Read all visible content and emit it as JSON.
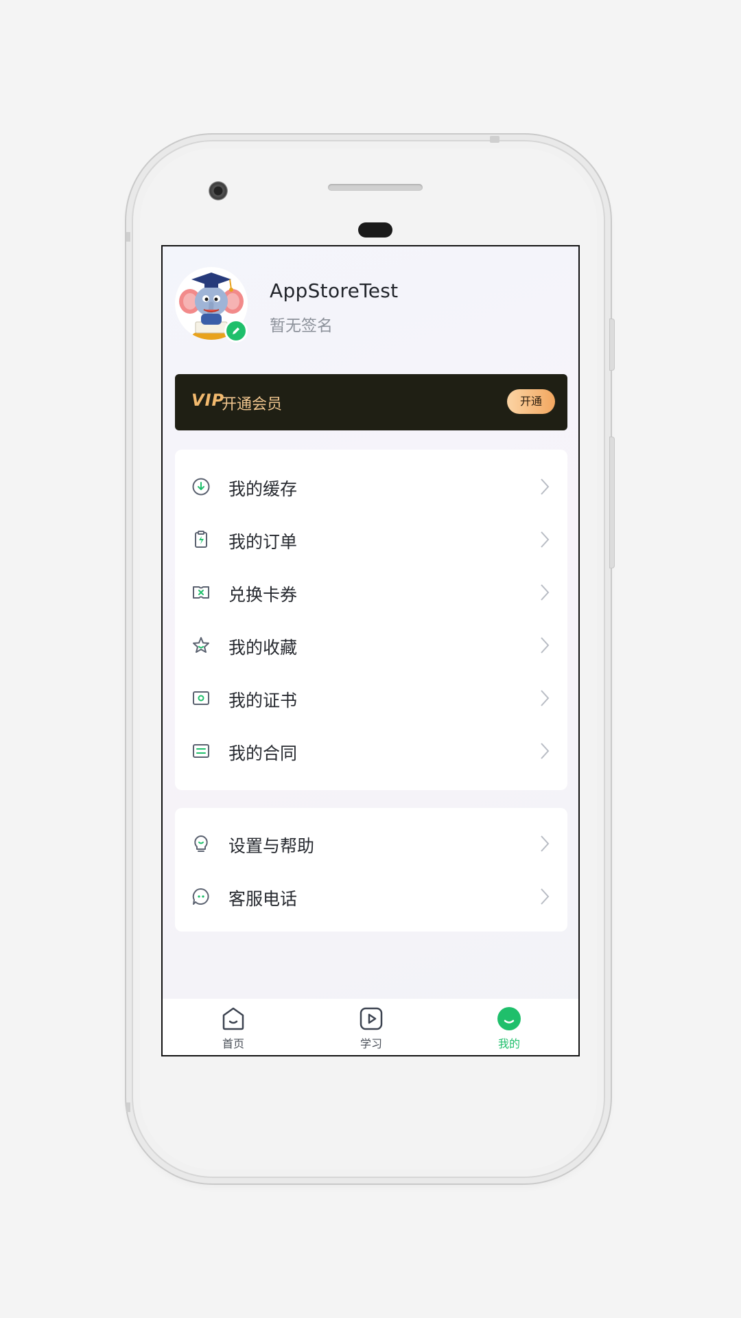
{
  "profile": {
    "username": "AppStoreTest",
    "signature": "暂无签名"
  },
  "vip": {
    "badge": "VIP",
    "label": "开通会员",
    "button": "开通"
  },
  "menu_primary": [
    {
      "label": "我的缓存",
      "icon": "download-circle-icon"
    },
    {
      "label": "我的订单",
      "icon": "clipboard-bolt-icon"
    },
    {
      "label": "兑换卡券",
      "icon": "ticket-icon"
    },
    {
      "label": "我的收藏",
      "icon": "star-icon"
    },
    {
      "label": "我的证书",
      "icon": "certificate-icon"
    },
    {
      "label": "我的合同",
      "icon": "contract-icon"
    }
  ],
  "menu_secondary": [
    {
      "label": "设置与帮助",
      "icon": "bulb-icon"
    },
    {
      "label": "客服电话",
      "icon": "chat-bubble-icon"
    }
  ],
  "tabbar": [
    {
      "label": "首页",
      "icon": "home-icon",
      "active": false
    },
    {
      "label": "学习",
      "icon": "play-icon",
      "active": false
    },
    {
      "label": "我的",
      "icon": "smile-icon",
      "active": true
    }
  ],
  "colors": {
    "accent": "#1fbf6b",
    "vip_bg": "#1f1f14",
    "vip_text": "#f0c58e"
  }
}
